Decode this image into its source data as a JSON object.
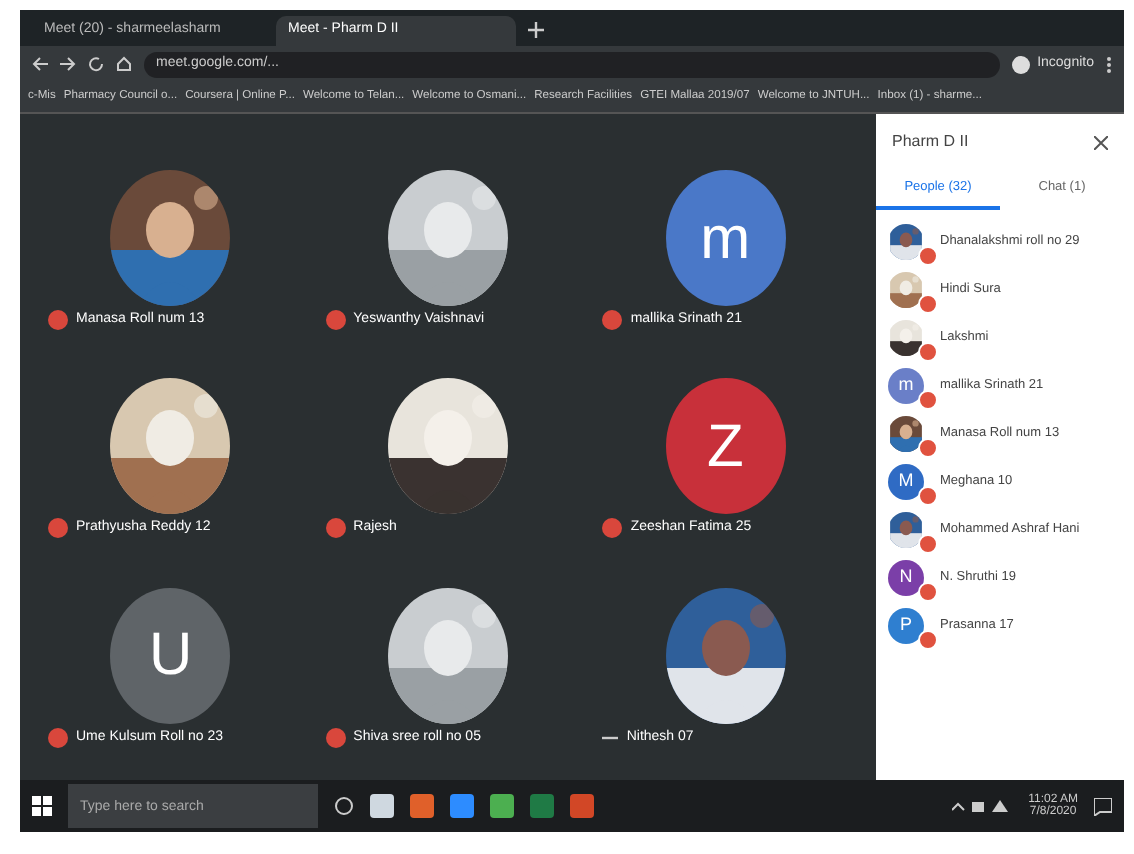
{
  "browser": {
    "tabs": [
      {
        "label": "Meet (20) - sharmeelasharm",
        "selected": false
      },
      {
        "label": "Meet - Pharm D II",
        "selected": true
      }
    ],
    "address": "meet.google.com/...",
    "profile": "Incognito",
    "bookmarks": [
      "c-Mis",
      "Pharmacy Council o...",
      "Coursera | Online P...",
      "Welcome to Telan...",
      "Welcome to Osmani...",
      "Research Facilities",
      "GTEI Mallaa 2019/07",
      "Welcome to JNTUH...",
      "Inbox (1) - sharme..."
    ]
  },
  "tiles": [
    {
      "name": "Manasa Roll num 13",
      "muted": true
    },
    {
      "name": "Yeswanthy Vaishnavi",
      "muted": true
    },
    {
      "name": "mallika Srinath 21",
      "kind": "letter",
      "letter": "m",
      "color": "#4a78c8",
      "muted": true
    },
    {
      "name": "Prathyusha Reddy 12",
      "muted": true
    },
    {
      "name": "Rajesh",
      "muted": true
    },
    {
      "name": "Zeeshan Fatima 25",
      "kind": "letter",
      "letter": "Z",
      "color": "#c8303a",
      "muted": true
    },
    {
      "name": "Ume Kulsum Roll no 23",
      "kind": "letter",
      "letter": "U",
      "color": "#5f6468",
      "muted": true
    },
    {
      "name": "Shiva sree roll no 05",
      "muted": true
    },
    {
      "name": "Nithesh 07",
      "muted": false
    }
  ],
  "panel": {
    "title": "Pharm D II",
    "tabs": [
      {
        "label": "People (32)",
        "selected": true
      },
      {
        "label": "Chat (1)",
        "selected": false
      }
    ],
    "people": [
      {
        "name": "Dhanalakshmi roll no 29"
      },
      {
        "name": "Hindi Sura"
      },
      {
        "name": "Lakshmi"
      },
      {
        "name": "mallika Srinath 21",
        "kind": "letter",
        "letter": "m",
        "color": "#6a7fc8"
      },
      {
        "name": "Manasa Roll num 13"
      },
      {
        "name": "Meghana 10",
        "kind": "letter",
        "letter": "M",
        "color": "#2f6bc4"
      },
      {
        "name": "Mohammed Ashraf Hani"
      },
      {
        "name": "N. Shruthi 19",
        "kind": "letter",
        "letter": "N",
        "color": "#7b3fa8"
      },
      {
        "name": "Prasanna 17",
        "kind": "letter",
        "letter": "P",
        "color": "#2f7fd0"
      }
    ]
  },
  "taskbar": {
    "search_placeholder": "Type here to search",
    "time": "11:02 AM",
    "date": "7/8/2020"
  }
}
